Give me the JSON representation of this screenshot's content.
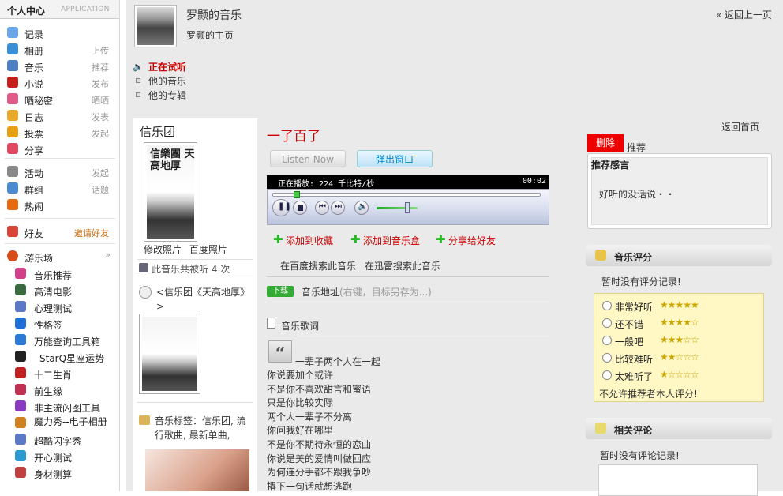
{
  "sidebar": {
    "header": {
      "title": "个人中心",
      "subtitle": "APPLICATION"
    },
    "groups": [
      {
        "label": "记录",
        "right": ""
      },
      {
        "label": "相册",
        "right": "上传"
      },
      {
        "label": "音乐",
        "right": "推荐"
      },
      {
        "label": "小说",
        "right": "发布"
      },
      {
        "label": "晒秘密",
        "right": "晒晒"
      },
      {
        "label": "日志",
        "right": "发表"
      },
      {
        "label": "投票",
        "right": "发起"
      },
      {
        "label": "分享",
        "right": ""
      },
      {
        "label": "活动",
        "right": "发起"
      },
      {
        "label": "群组",
        "right": "话题"
      },
      {
        "label": "热闹",
        "right": ""
      },
      {
        "label": "好友",
        "right": "邀请好友"
      }
    ],
    "games_title": "游乐场",
    "games": [
      "音乐推荐",
      "高清电影",
      "心理测试",
      "性格签",
      "万能查询工具箱",
      "StarQ星座运势",
      "十二生肖",
      "前生缘",
      "非主流闪图工具",
      "魔力秀--电子相册",
      "超酷闪字秀",
      "开心测试",
      "身材测算"
    ]
  },
  "header": {
    "title": "罗颢的音乐",
    "home_link": "罗颢的主页",
    "back_link": "« 返回上一页"
  },
  "tabs": [
    "正在试听",
    "他的音乐",
    "他的专辑"
  ],
  "left_panel": {
    "artist": "信乐团",
    "cover_text": "信樂團 天高地厚",
    "photo_links": [
      "修改照片",
      "百度照片"
    ],
    "play_count": "此音乐共被听 4 次",
    "album_title": "<信乐团《天高地厚》>",
    "tags": "音乐标签：信乐团, 流行歌曲, 最新单曲,"
  },
  "song": {
    "title": "一了百了",
    "listen_now": "Listen Now",
    "popup": "弹出窗口",
    "status": "正在播放: 224 千比特/秒",
    "time": "00:02",
    "actions": [
      "添加到收藏",
      "添加到音乐盒",
      "分享给好友"
    ],
    "search_baidu": "在百度搜索此音乐",
    "search_xunlei": "在迅雷搜索此音乐",
    "download_badge": "下载",
    "download_label": "音乐地址",
    "download_hint": "(右键，目标另存为...)",
    "lyrics_title": "音乐歌词",
    "lyrics": [
      "一辈子两个人在一起",
      "你说要加个或许",
      "不是你不喜欢甜言和蜜语",
      "只是你比较实际",
      "两个人一辈子不分离",
      "你问我好在哪里",
      "不是你不期待永恒的恋曲",
      "你说是美的爱情叫做回应",
      "为何连分手都不跟我争吵",
      "撂下一句话就想逃跑"
    ]
  },
  "right_panel": {
    "back_home": "返回首页",
    "delete_btn": "删除",
    "recommend": "推荐",
    "comment_title": "推荐感言",
    "comment_text": "好听的没话说・・",
    "rating_title": "音乐评分",
    "no_rating": "暂时没有评分记录!",
    "ratings": [
      {
        "label": "非常好听",
        "stars": 5
      },
      {
        "label": "还不错",
        "stars": 4
      },
      {
        "label": "一般吧",
        "stars": 3
      },
      {
        "label": "比较难听",
        "stars": 2
      },
      {
        "label": "太难听了",
        "stars": 1
      }
    ],
    "no_self": "不允许推荐者本人评分!",
    "related_title": "相关评论",
    "no_comments": "暂时没有评论记录!"
  },
  "colors": {
    "accent_red": "#cc0000",
    "green": "#22aa22",
    "delete_red": "#ee0000"
  }
}
